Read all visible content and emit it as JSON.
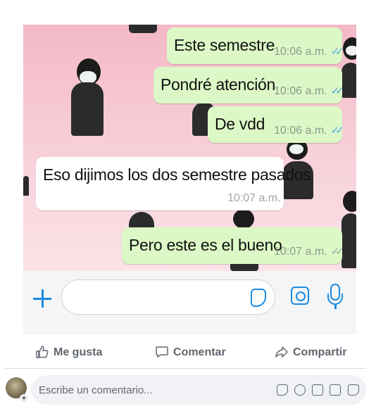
{
  "chat": {
    "messages": [
      {
        "direction": "outgoing",
        "text": "Este semestre",
        "time": "10:06 a.m.",
        "status": "read"
      },
      {
        "direction": "outgoing",
        "text": "Pondré atención",
        "time": "10:06 a.m.",
        "status": "read"
      },
      {
        "direction": "outgoing",
        "text": "De vdd",
        "time": "10:06 a.m.",
        "status": "read"
      },
      {
        "direction": "incoming",
        "text": "Eso dijimos los dos semestre pasados",
        "time": "10:07 a.m."
      },
      {
        "direction": "outgoing",
        "text": "Pero este es el bueno",
        "time": "10:07 a.m.",
        "status": "delivered"
      }
    ],
    "tick_glyph": "✓✓",
    "colors": {
      "outgoing_bubble": "#dcf8c6",
      "incoming_bubble": "#ffffff",
      "read_ticks": "#4fa9de",
      "accent": "#1a8be0"
    }
  },
  "composer": {
    "input_value": "",
    "icons": [
      "plus-icon",
      "sticker-icon",
      "camera-icon",
      "microphone-icon"
    ]
  },
  "post_actions": {
    "like_label": "Me gusta",
    "comment_label": "Comentar",
    "share_label": "Compartir"
  },
  "comment": {
    "placeholder": "Escribe un comentario...",
    "icons": [
      "sticker-icon",
      "emoji-icon",
      "camera-icon",
      "gif-icon",
      "sticker-face-icon"
    ]
  }
}
